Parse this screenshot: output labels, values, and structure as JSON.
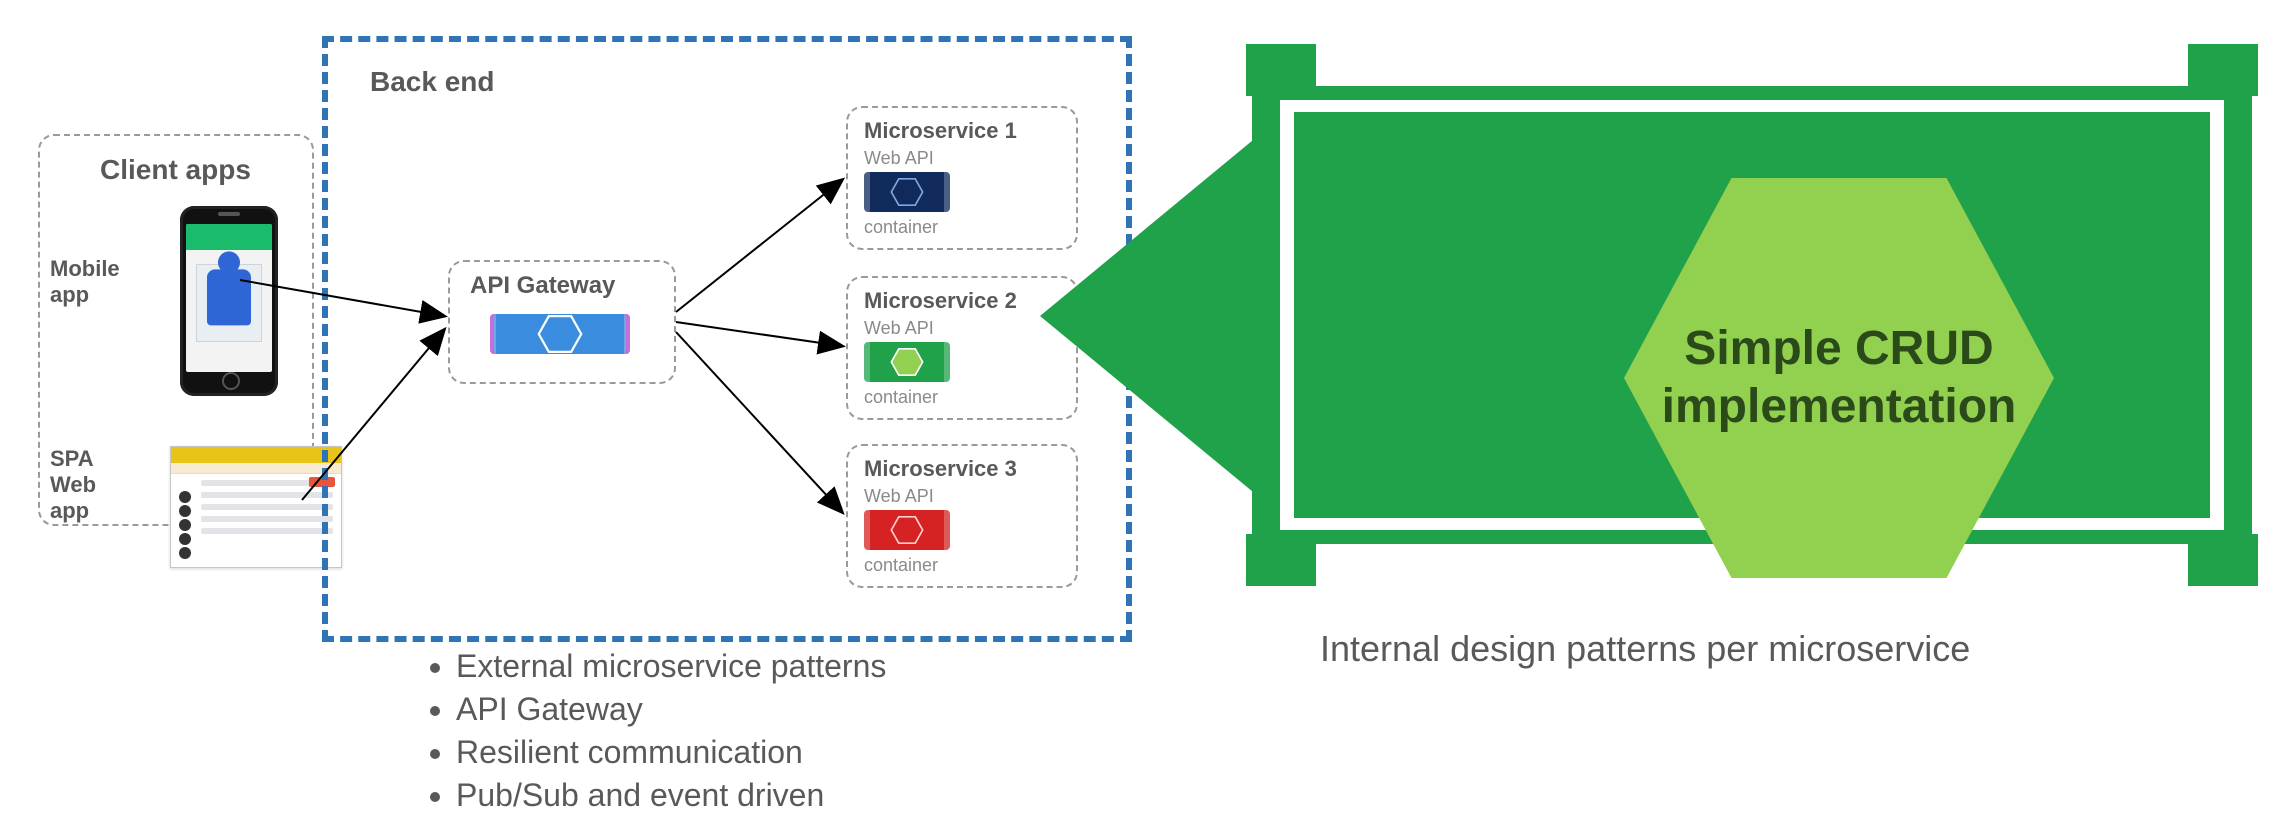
{
  "client": {
    "title": "Client apps",
    "mobile_label": "Mobile\napp",
    "spa_label": "SPA\nWeb\napp"
  },
  "backend": {
    "title": "Back end",
    "api_gateway": {
      "title": "API Gateway",
      "icon": "hexagon-container-icon",
      "color_bg": "#3a8dde",
      "color_edge": "#b23fcf"
    },
    "microservices": [
      {
        "name": "Microservice 1",
        "sub": "Web API",
        "foot": "container",
        "color_bg": "#0f2a5b",
        "color_hex": "#2e5aa8"
      },
      {
        "name": "Microservice 2",
        "sub": "Web API",
        "foot": "container",
        "color_bg": "#1fa24a",
        "color_hex": "#92d050"
      },
      {
        "name": "Microservice 3",
        "sub": "Web API",
        "foot": "container",
        "color_bg": "#d62222",
        "color_hex": "#ff4a4a"
      }
    ]
  },
  "bullets": [
    "External microservice patterns",
    "API Gateway",
    "Resilient communication",
    "Pub/Sub and event driven"
  ],
  "zoom": {
    "headline": "Simple CRUD\nimplementation",
    "caption": "Internal design patterns per microservice",
    "color_bg": "#1fa24a",
    "color_hex": "#92d050"
  }
}
